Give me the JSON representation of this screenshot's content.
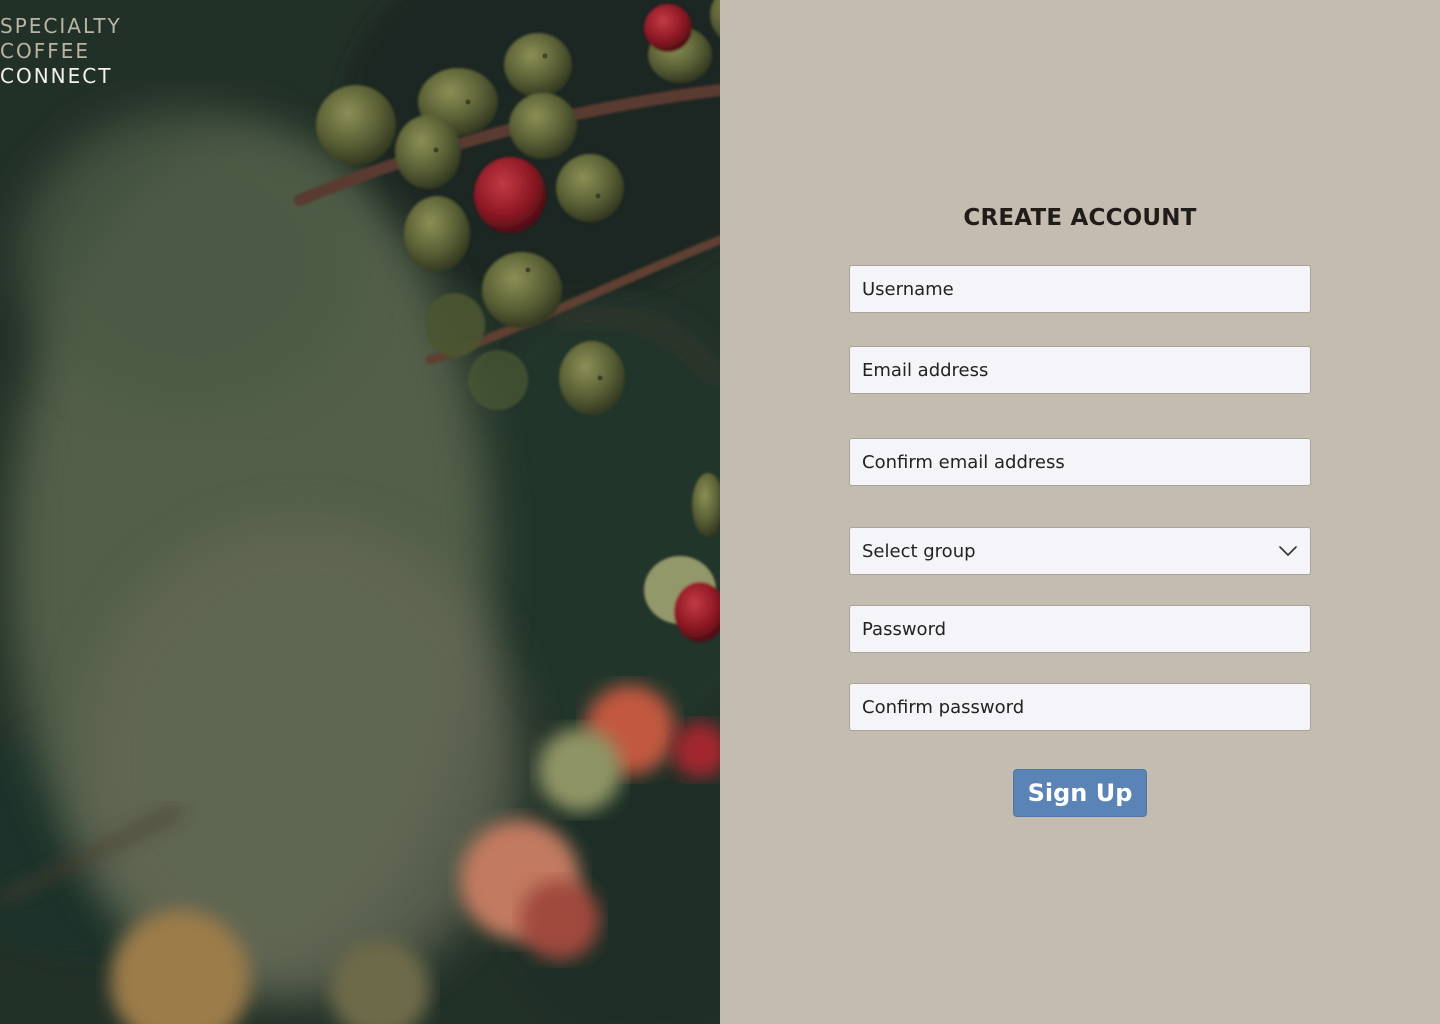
{
  "brand": {
    "line1": "SPECIALTY",
    "line2": "COFFEE",
    "line3": "CONNECT"
  },
  "form": {
    "title": "CREATE ACCOUNT",
    "username_placeholder": "Username",
    "email_placeholder": "Email address",
    "confirm_email_placeholder": "Confirm email address",
    "group_selected": "Select group",
    "password_placeholder": "Password",
    "confirm_password_placeholder": "Confirm password",
    "submit_label": "Sign Up"
  },
  "colors": {
    "panel_background": "#c4bcaf",
    "field_background": "#f5f4f8",
    "button_accent": "#5b84b6"
  },
  "icons": {
    "select_chevron": "chevron-down-icon"
  }
}
